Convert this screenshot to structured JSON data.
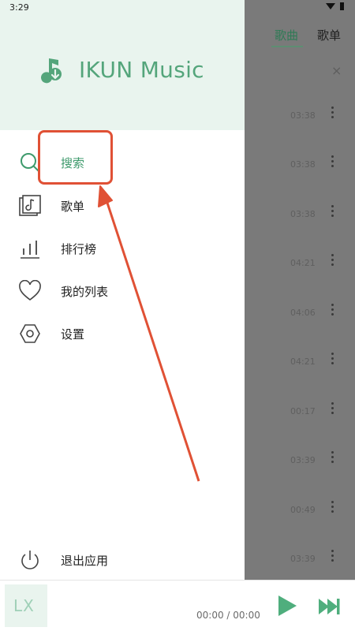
{
  "status_bar": {
    "time": "3:29",
    "icons": "▾ ▮"
  },
  "background": {
    "tabs": [
      {
        "label": "歌曲"
      },
      {
        "label": "歌单"
      }
    ],
    "close_glyph": "×",
    "durations": [
      "03:38",
      "03:38",
      "03:38",
      "04:21",
      "04:06",
      "04:21",
      "00:17",
      "03:39",
      "00:49",
      "03:39"
    ]
  },
  "drawer": {
    "app_name": "IKUN Music",
    "menu": [
      {
        "label": "搜索",
        "icon": "search-icon",
        "active": true
      },
      {
        "label": "歌单",
        "icon": "playlist-icon",
        "active": false
      },
      {
        "label": "排行榜",
        "icon": "chart-icon",
        "active": false
      },
      {
        "label": "我的列表",
        "icon": "heart-icon",
        "active": false
      },
      {
        "label": "设置",
        "icon": "settings-icon",
        "active": false
      }
    ],
    "exit": {
      "label": "退出应用",
      "icon": "power-icon"
    }
  },
  "player": {
    "thumb_text": "LX",
    "time": "00:00 / 00:00"
  },
  "colors": {
    "accent": "#54a57b",
    "highlight": "#e05135",
    "overlay": "#7a7a7a"
  }
}
